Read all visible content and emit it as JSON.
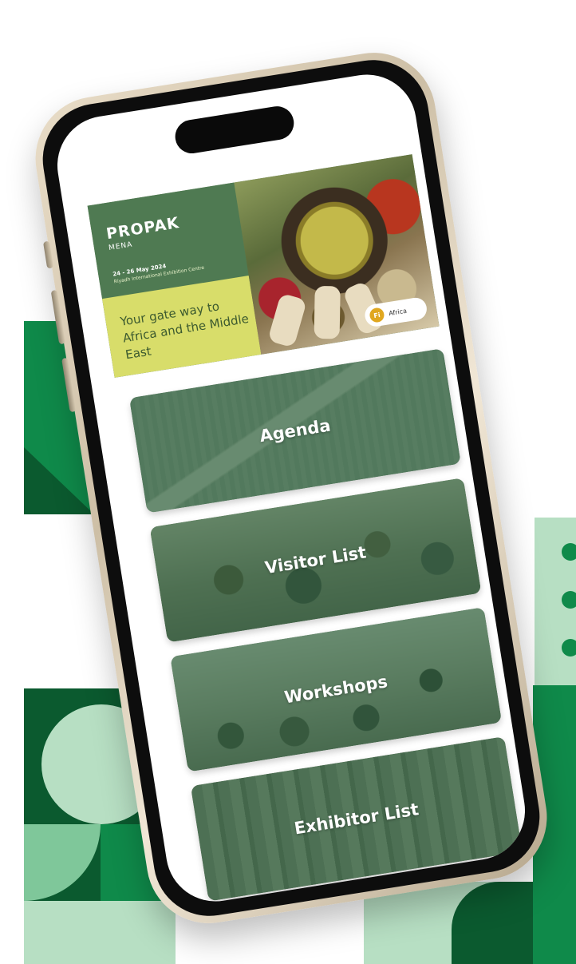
{
  "banner": {
    "logo": "PROPAK",
    "logo_sub": "MENA",
    "dates": "24 - 26 May 2024",
    "venue": "Riyadh International Exhibition Centre",
    "tagline": "Your gate way to Africa and the Middle East",
    "badge_icon": "Fi",
    "badge_text": "Africa"
  },
  "menu": {
    "items": [
      {
        "label": "Agenda"
      },
      {
        "label": "Visitor List"
      },
      {
        "label": "Workshops"
      },
      {
        "label": "Exhibitor List"
      }
    ]
  },
  "colors": {
    "brand_green": "#0f8a4a",
    "dark_green": "#0b5a2f",
    "light_green": "#b7dfc3",
    "card_overlay": "#2e623c",
    "banner_yellow": "#d8dd6a"
  }
}
